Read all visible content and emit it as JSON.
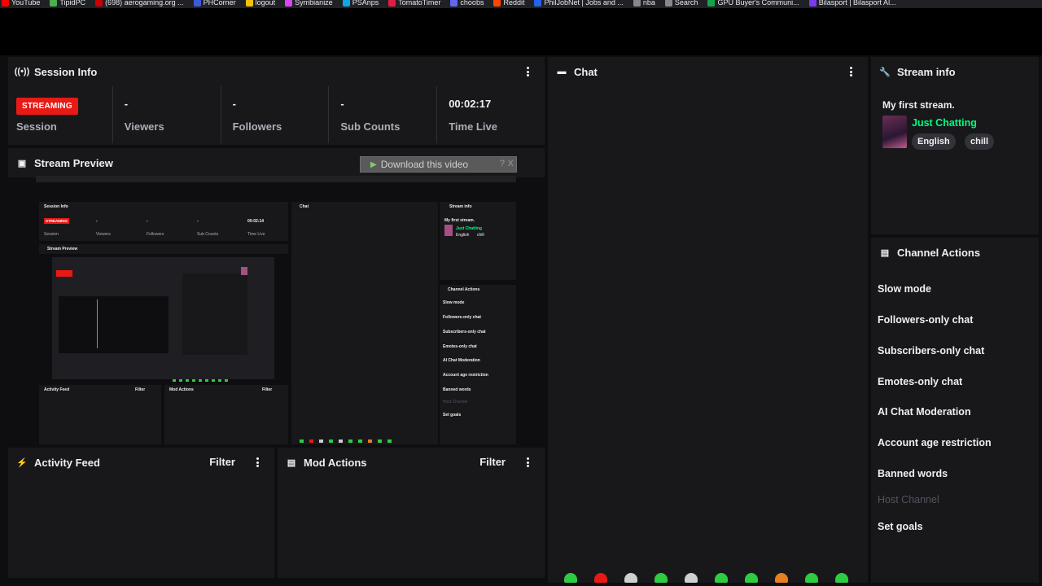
{
  "bookmarks": [
    {
      "label": "YouTube",
      "color": "#ff0000"
    },
    {
      "label": "TipidPC",
      "color": "#4caf50"
    },
    {
      "label": "(698) aerogaming.org ...",
      "color": "#cc0000"
    },
    {
      "label": "PHCorner",
      "color": "#3b5bdb"
    },
    {
      "label": "logout",
      "color": "#f4c20d"
    },
    {
      "label": "Symbianize",
      "color": "#d946ef"
    },
    {
      "label": "PSAnps",
      "color": "#0ea5e9"
    },
    {
      "label": "TomatoTimer",
      "color": "#e11d48"
    },
    {
      "label": "choobs",
      "color": "#6366f1"
    },
    {
      "label": "Reddit",
      "color": "#ff4500"
    },
    {
      "label": "PhilJobNet | Jobs and ...",
      "color": "#2563eb"
    },
    {
      "label": "nba",
      "color": "#888888"
    },
    {
      "label": "Search",
      "color": "#888888"
    },
    {
      "label": "GPU Buyer's Communi...",
      "color": "#16a34a"
    },
    {
      "label": "Bilasport | Bilasport Al...",
      "color": "#7c3aed"
    }
  ],
  "session_info": {
    "title": "Session Info",
    "stats": [
      {
        "badge": "STREAMING",
        "label": "Session"
      },
      {
        "value": "-",
        "label": "Viewers"
      },
      {
        "value": "-",
        "label": "Followers"
      },
      {
        "value": "-",
        "label": "Sub Counts"
      },
      {
        "value": "00:02:17",
        "label": "Time Live"
      }
    ]
  },
  "stream_preview": {
    "title": "Stream Preview",
    "download_label": "Download this video",
    "help": "?",
    "close": "X"
  },
  "chat": {
    "title": "Chat"
  },
  "stream_info": {
    "title": "Stream info",
    "stream_title": "My first stream.",
    "category": "Just Chatting",
    "tags": [
      "English",
      "chill"
    ]
  },
  "channel_actions": {
    "title": "Channel Actions",
    "items": [
      {
        "label": "Slow mode",
        "disabled": false
      },
      {
        "label": "Followers-only chat",
        "disabled": false
      },
      {
        "label": "Subscribers-only chat",
        "disabled": false
      },
      {
        "label": "Emotes-only chat",
        "disabled": false
      },
      {
        "label": "AI Chat Moderation",
        "disabled": false
      },
      {
        "label": "Account age restriction",
        "disabled": false
      },
      {
        "label": "Banned words",
        "disabled": false
      },
      {
        "label": "Host Channel",
        "disabled": true
      },
      {
        "label": "Set goals",
        "disabled": false
      }
    ]
  },
  "activity_feed": {
    "title": "Activity Feed",
    "filter": "Filter"
  },
  "mod_actions": {
    "title": "Mod Actions",
    "filter": "Filter"
  },
  "mini_preview": {
    "session_title": "Session Info",
    "streaming": "STREAMING",
    "session": "Session",
    "viewers": "Viewers",
    "followers": "Followers",
    "sub_counts": "Sub Counts",
    "time_live_value": "00:02:14",
    "time_live": "Time Live",
    "dash": "-",
    "stream_preview": "Stream Preview",
    "chat": "Chat",
    "stream_info": "Stream info",
    "stream_title": "My first stream.",
    "category": "Just Chatting",
    "tag1": "English",
    "tag2": "chill",
    "channel_actions": "Channel Actions",
    "actions": [
      "Slow mode",
      "Followers-only chat",
      "Subscribers-only chat",
      "Emotes-only chat",
      "AI Chat Moderation",
      "Account age restriction",
      "Banned words",
      "Host Channel",
      "Set goals"
    ],
    "activity_feed": "Activity Feed",
    "mod_actions": "Mod Actions",
    "filter": "Filter"
  },
  "colors": {
    "accent_green": "#00ff7f",
    "live_red": "#e91916",
    "panel_bg": "#18181b",
    "page_bg": "#0e0e10"
  },
  "icons": {
    "session_info": "broadcast-icon",
    "stream_preview": "preview-icon",
    "chat": "chat-bubble-icon",
    "stream_info": "wrench-icon",
    "channel_actions": "actions-icon",
    "activity_feed": "lightning-icon",
    "mod_actions": "mod-icon"
  }
}
